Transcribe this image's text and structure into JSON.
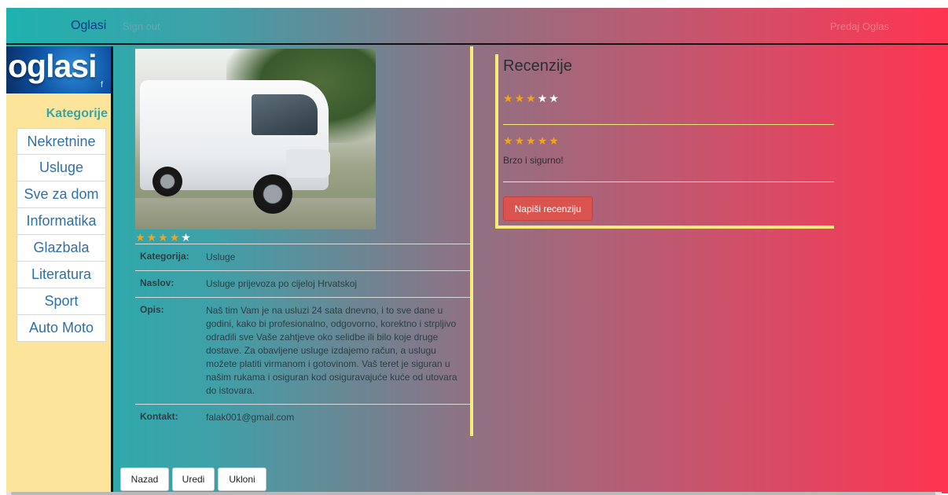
{
  "navbar": {
    "brand": "Oglasi",
    "sign_out": "Sign out",
    "post_ad": "Predaj Oglas"
  },
  "sidebar": {
    "logo_text": "oglasi",
    "logo_small": "f",
    "heading": "Kategorije",
    "items": [
      {
        "label": "Nekretnine"
      },
      {
        "label": "Usluge"
      },
      {
        "label": "Sve za dom"
      },
      {
        "label": "Informatika"
      },
      {
        "label": "Glazbala"
      },
      {
        "label": "Literatura"
      },
      {
        "label": "Sport"
      },
      {
        "label": "Auto Moto"
      }
    ]
  },
  "listing": {
    "image_alt": "white van",
    "rating": 4,
    "rating_max": 5,
    "rows": [
      {
        "label": "Kategorija:",
        "value": "Usluge"
      },
      {
        "label": "Naslov:",
        "value": "Usluge prijevoza po cijeloj Hrvatskoj"
      },
      {
        "label": "Opis:",
        "value": "Naš tim Vam je na usluzi 24 sata dnevno, i to sve dane u godini, kako bi profesionalno, odgovorno, korektno i strpljivo odradili sve Vaše zahtjeve oko selidbe ili bilo koje druge dostave. Za obavljene usluge izdajemo račun, a uslugu možete platiti virmanom i gotovinom. Vaš teret je siguran u našim rukama i osiguran kod osiguravajuće kuće od utovara do istovara."
      },
      {
        "label": "Kontakt:",
        "value": "falak001@gmail.com"
      }
    ]
  },
  "reviews": {
    "title": "Recenzije",
    "average_rating": 3,
    "items": [
      {
        "rating": 5,
        "text": "Brzo i sigurno!"
      }
    ],
    "write_label": "Napiši recenziju"
  },
  "actions": {
    "back": "Nazad",
    "edit": "Uredi",
    "remove": "Ukloni"
  },
  "colors": {
    "gradient_left": "#1fb2ae",
    "gradient_right": "#ff3450",
    "sidebar_bg": "#fce49b",
    "accent_yellow": "#f8ec7a",
    "star_on": "#f2a51c",
    "danger_button": "#d9534f"
  }
}
